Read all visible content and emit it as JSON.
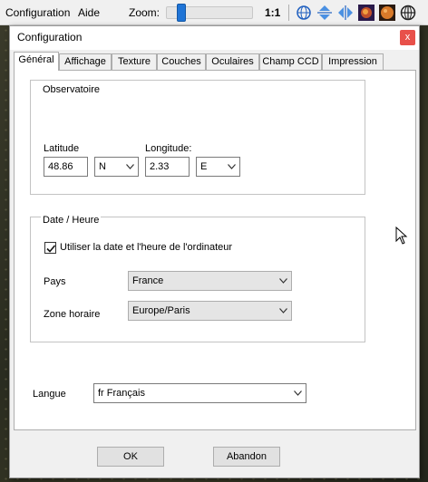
{
  "app": {
    "menu": [
      "Configuration",
      "Aide"
    ],
    "zoom_label": "Zoom:",
    "zoom_level": 0.12,
    "zoom_ratio": "1:1",
    "toolbar_icons": [
      "globe-grid-icon",
      "mirror-vertical-icon",
      "mirror-horizontal-icon",
      "nebula-icon",
      "planet-icon",
      "grid-icon"
    ]
  },
  "dialog": {
    "title": "Configuration",
    "close": "x",
    "tabs": [
      "Général",
      "Affichage",
      "Texture",
      "Couches",
      "Oculaires",
      "Champ CCD",
      "Impression"
    ],
    "active_tab": "Général",
    "observatory": {
      "legend": "Observatoire",
      "latitude_label": "Latitude",
      "latitude_value": "48.86",
      "latitude_hemisphere": "N",
      "longitude_label": "Longitude:",
      "longitude_value": "2.33",
      "longitude_direction": "E"
    },
    "datetime": {
      "legend": "Date / Heure",
      "use_system_time_label": "Utiliser la date et l'heure de l'ordinateur",
      "use_system_time_checked": true,
      "country_label": "Pays",
      "country_value": "France",
      "timezone_label": "Zone horaire",
      "timezone_value": "Europe/Paris"
    },
    "language_label": "Langue",
    "language_value": "fr Français",
    "ok_label": "OK",
    "cancel_label": "Abandon"
  },
  "colors": {
    "accent": "#1f74d6",
    "close_button": "#e8504a",
    "sky_background": "#2c2c22"
  }
}
